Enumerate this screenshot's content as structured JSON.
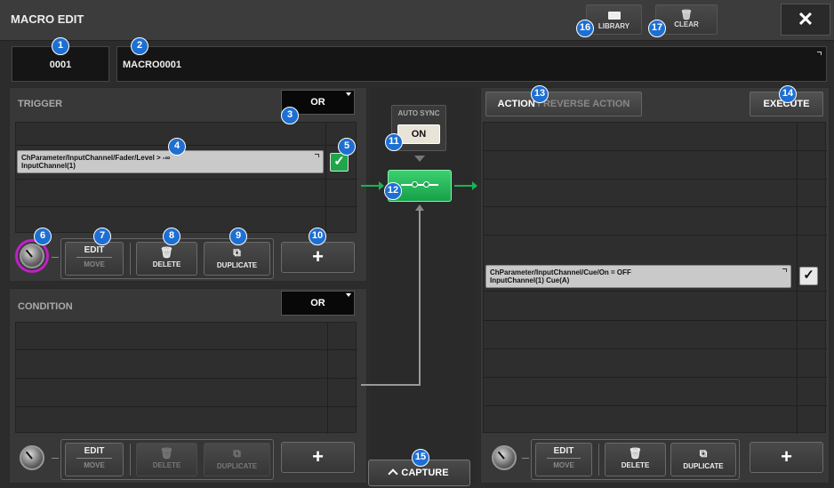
{
  "window": {
    "title": "MACRO EDIT",
    "library_label": "LIBRARY",
    "clear_label": "CLEAR",
    "close_glyph": "✕"
  },
  "macro": {
    "number": "0001",
    "name": "MACRO0001"
  },
  "trigger": {
    "label": "TRIGGER",
    "operator": "OR",
    "item": {
      "line1": "ChParameter/InputChannel/Fader/Level > -∞",
      "line2": "InputChannel(1)",
      "checked": true
    }
  },
  "condition": {
    "label": "CONDITION",
    "operator": "OR"
  },
  "toolbar": {
    "edit_label": "EDIT",
    "move_label": "MOVE",
    "delete_label": "DELETE",
    "duplicate_label": "DUPLICATE",
    "add_label": "+"
  },
  "sync": {
    "label": "AUTO SYNC",
    "state": "ON"
  },
  "capture": {
    "label": "CAPTURE"
  },
  "action": {
    "tab_action": "ACTION",
    "tab_reverse": "REVERSE ACTION",
    "execute_label": "EXECUTE",
    "item": {
      "line1": "ChParameter/InputChannel/Cue/On = OFF",
      "line2": "InputChannel(1) Cue(A)",
      "checked": true
    }
  },
  "callouts": [
    "1",
    "2",
    "3",
    "4",
    "5",
    "6",
    "7",
    "8",
    "9",
    "10",
    "11",
    "12",
    "13",
    "14",
    "15",
    "16",
    "17"
  ],
  "colors": {
    "accent_green": "#18b454",
    "callout_blue": "#1e6fd2",
    "knob_ring": "#c020c8",
    "check_green": "#1fa64a"
  }
}
